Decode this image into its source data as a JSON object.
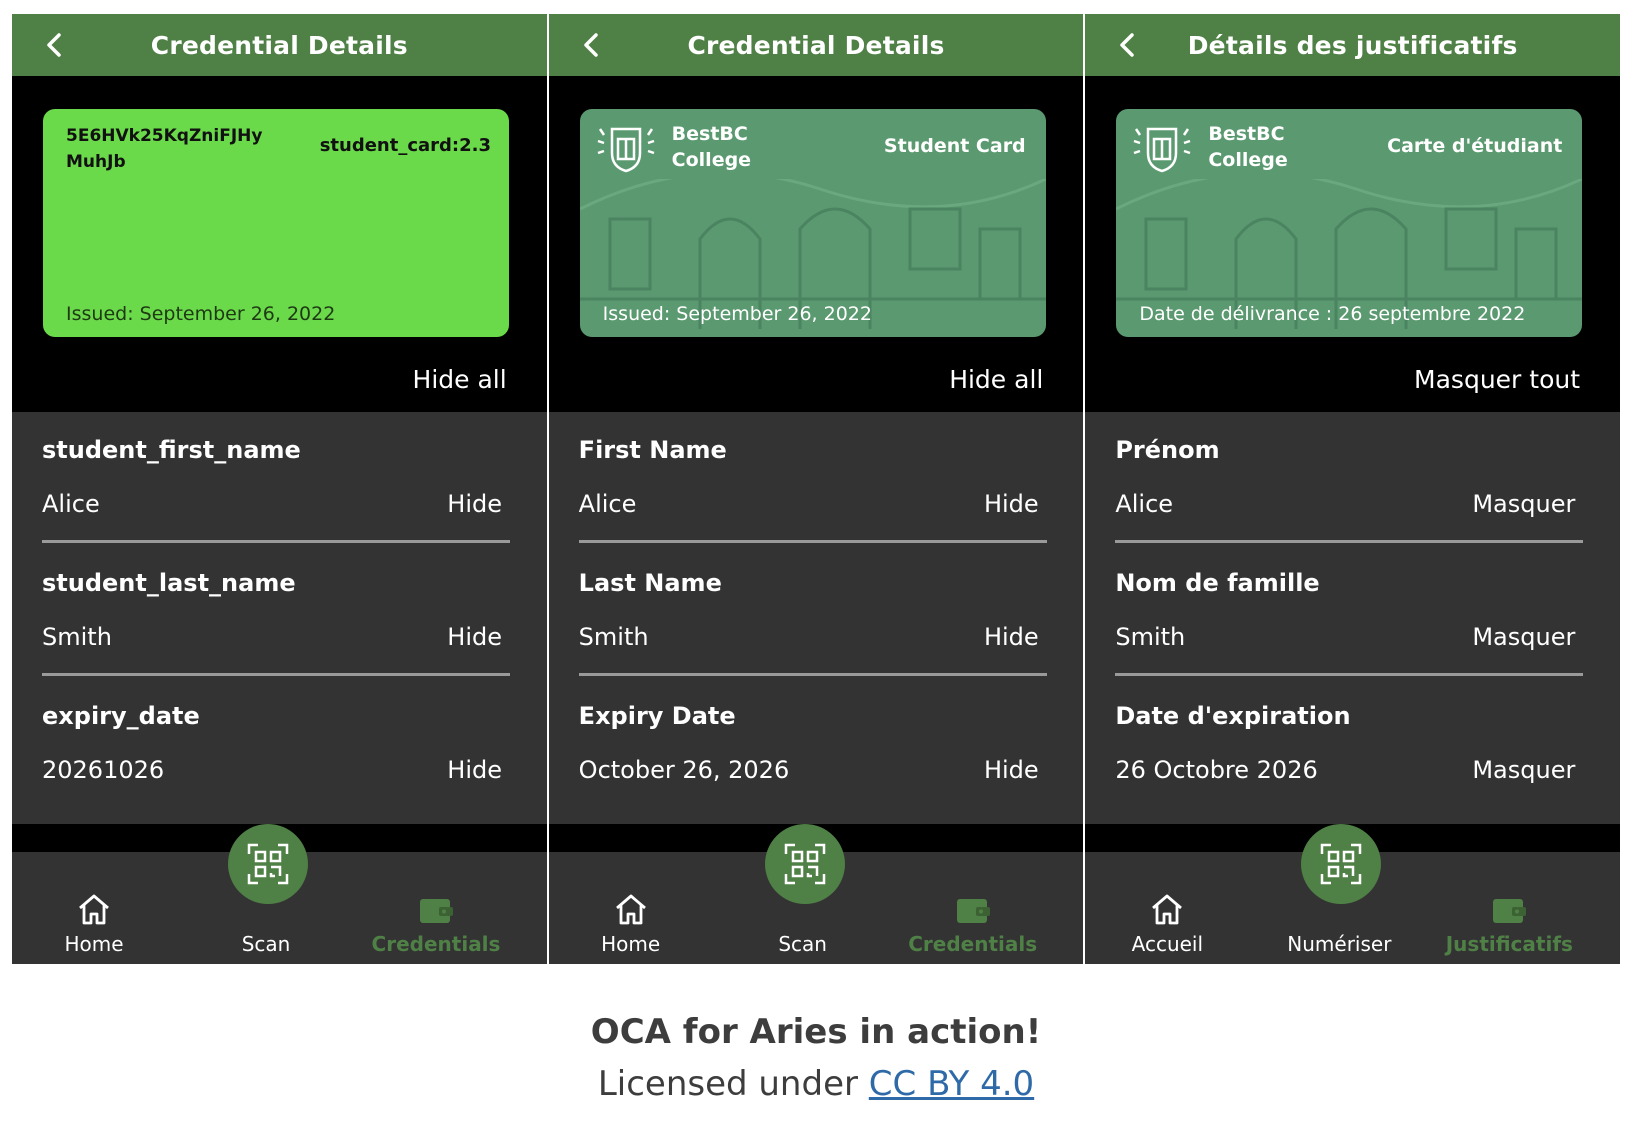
{
  "colors": {
    "header_green": "#4f8045",
    "card_green": "#6ad94a",
    "card_branded": "#5b9a70",
    "panel_dark": "#333334",
    "active_nav": "#4f8045"
  },
  "screens": [
    {
      "title": "Credential Details",
      "card": {
        "style": "plain",
        "id": "5E6HVk25KqZniFJHy MuhJb",
        "schema": "student_card:2.3",
        "issued": "Issued: September 26, 2022"
      },
      "hide_all": "Hide all",
      "attributes": [
        {
          "label": "student_first_name",
          "value": "Alice",
          "action": "Hide"
        },
        {
          "label": "student_last_name",
          "value": "Smith",
          "action": "Hide"
        },
        {
          "label": "expiry_date",
          "value": "20261026",
          "action": "Hide"
        }
      ],
      "nav": {
        "home": "Home",
        "scan": "Scan",
        "credentials": "Credentials"
      }
    },
    {
      "title": "Credential Details",
      "card": {
        "style": "branded",
        "college": "BestBC College",
        "college_line1": "BestBC",
        "college_line2": "College",
        "type": "Student Card",
        "issued": "Issued: September 26, 2022"
      },
      "hide_all": "Hide all",
      "attributes": [
        {
          "label": "First Name",
          "value": "Alice",
          "action": "Hide"
        },
        {
          "label": "Last Name",
          "value": "Smith",
          "action": "Hide"
        },
        {
          "label": "Expiry Date",
          "value": "October 26, 2026",
          "action": "Hide"
        }
      ],
      "nav": {
        "home": "Home",
        "scan": "Scan",
        "credentials": "Credentials"
      }
    },
    {
      "title": "Détails des justificatifs",
      "card": {
        "style": "branded",
        "college": "BestBC College",
        "college_line1": "BestBC",
        "college_line2": "College",
        "type": "Carte d'étudiant",
        "issued": "Date de délivrance : 26 septembre 2022"
      },
      "hide_all": "Masquer tout",
      "attributes": [
        {
          "label": "Prénom",
          "value": "Alice",
          "action": "Masquer"
        },
        {
          "label": "Nom de famille",
          "value": "Smith",
          "action": "Masquer"
        },
        {
          "label": "Date d'expiration",
          "value": "26 Octobre 2026",
          "action": "Masquer"
        }
      ],
      "nav": {
        "home": "Accueil",
        "scan": "Numériser",
        "credentials": "Justificatifs"
      }
    }
  ],
  "caption": "OCA for Aries in action!",
  "license": {
    "prefix": "Licensed under ",
    "link_text": "CC BY 4.0"
  }
}
